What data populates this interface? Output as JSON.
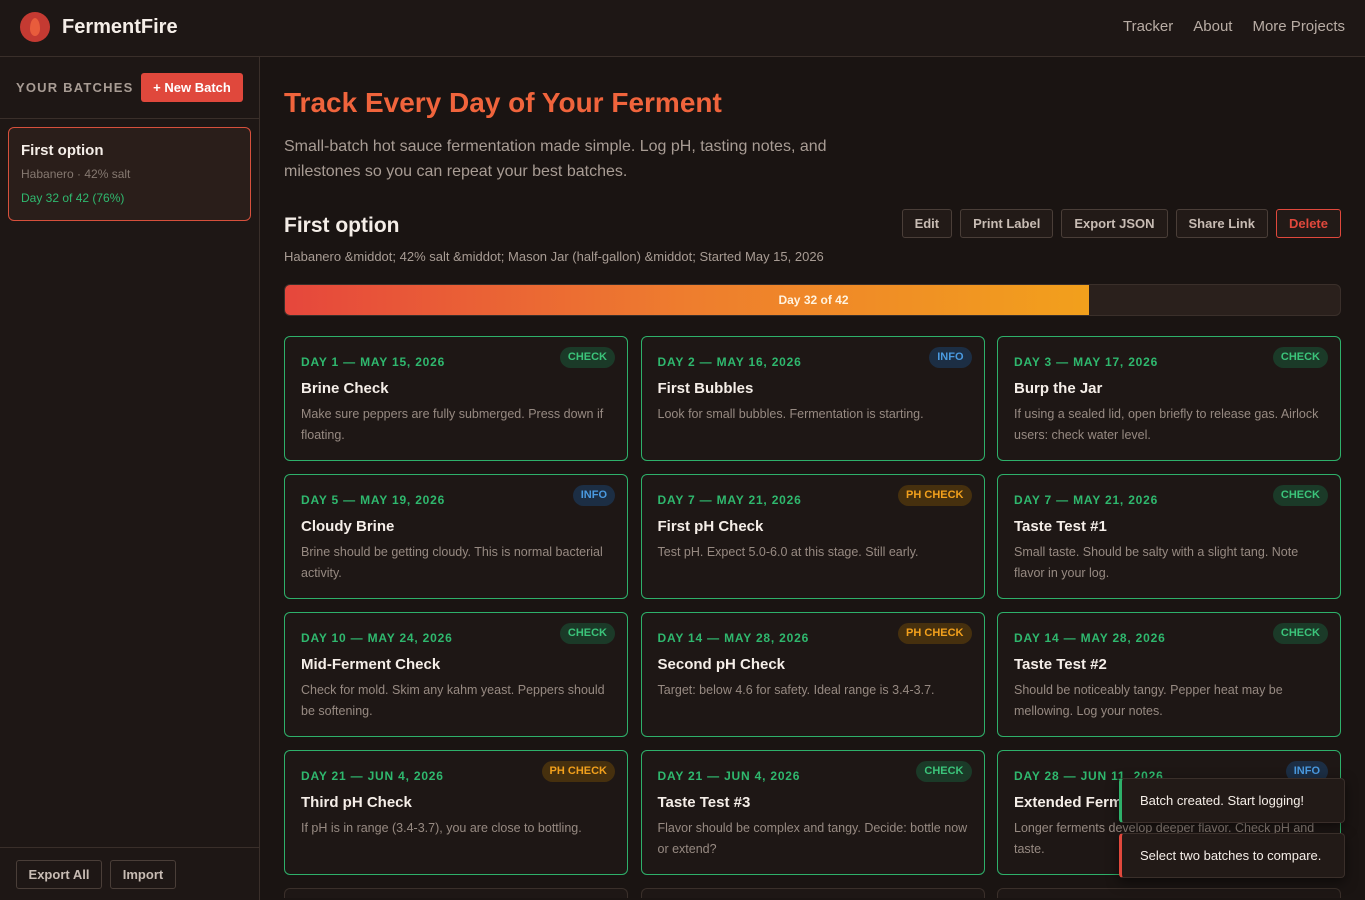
{
  "app": {
    "name": "FermentFire"
  },
  "nav": {
    "tracker": "Tracker",
    "about": "About",
    "more": "More Projects"
  },
  "sidebar": {
    "title": "YOUR BATCHES",
    "new_batch": "+ New Batch",
    "batches": [
      {
        "name": "First option",
        "meta": "Habanero · 42% salt",
        "progress": "Day 32 of 42 (76%)"
      }
    ],
    "export_all": "Export All",
    "import": "Import"
  },
  "hero": {
    "title": "Track Every Day of Your Ferment",
    "subtitle": "Small-batch hot sauce fermentation made simple. Log pH, tasting notes, and milestones so you can repeat your best batches."
  },
  "batch": {
    "title": "First option",
    "meta": "Habanero &middot; 42% salt &middot; Mason Jar (half-gallon) &middot; Started May 15, 2026",
    "actions": {
      "edit": "Edit",
      "print": "Print Label",
      "export": "Export JSON",
      "share": "Share Link",
      "delete": "Delete"
    },
    "progress_label": "Day 32 of 42",
    "progress_fraction": 0.7619
  },
  "badge_colors": {
    "check": "#3bc47a",
    "info": "#4a9ae0",
    "ph": "#f2a01c"
  },
  "milestones": [
    {
      "date": "DAY 1 — MAY 15, 2026",
      "badge": "CHECK",
      "type": "check",
      "title": "Brine Check",
      "text": "Make sure peppers are fully submerged. Press down if floating."
    },
    {
      "date": "DAY 2 — MAY 16, 2026",
      "badge": "INFO",
      "type": "info",
      "title": "First Bubbles",
      "text": "Look for small bubbles. Fermentation is starting."
    },
    {
      "date": "DAY 3 — MAY 17, 2026",
      "badge": "CHECK",
      "type": "check",
      "title": "Burp the Jar",
      "text": "If using a sealed lid, open briefly to release gas. Airlock users: check water level."
    },
    {
      "date": "DAY 5 — MAY 19, 2026",
      "badge": "INFO",
      "type": "info",
      "title": "Cloudy Brine",
      "text": "Brine should be getting cloudy. This is normal bacterial activity."
    },
    {
      "date": "DAY 7 — MAY 21, 2026",
      "badge": "PH CHECK",
      "type": "ph",
      "title": "First pH Check",
      "text": "Test pH. Expect 5.0-6.0 at this stage. Still early."
    },
    {
      "date": "DAY 7 — MAY 21, 2026",
      "badge": "CHECK",
      "type": "check",
      "title": "Taste Test #1",
      "text": "Small taste. Should be salty with a slight tang. Note flavor in your log."
    },
    {
      "date": "DAY 10 — MAY 24, 2026",
      "badge": "CHECK",
      "type": "check",
      "title": "Mid-Ferment Check",
      "text": "Check for mold. Skim any kahm yeast. Peppers should be softening."
    },
    {
      "date": "DAY 14 — MAY 28, 2026",
      "badge": "PH CHECK",
      "type": "ph",
      "title": "Second pH Check",
      "text": "Target: below 4.6 for safety. Ideal range is 3.4-3.7."
    },
    {
      "date": "DAY 14 — MAY 28, 2026",
      "badge": "CHECK",
      "type": "check",
      "title": "Taste Test #2",
      "text": "Should be noticeably tangy. Pepper heat may be mellowing. Log your notes."
    },
    {
      "date": "DAY 21 — JUN 4, 2026",
      "badge": "PH CHECK",
      "type": "ph",
      "title": "Third pH Check",
      "text": "If pH is in range (3.4-3.7), you are close to bottling."
    },
    {
      "date": "DAY 21 — JUN 4, 2026",
      "badge": "CHECK",
      "type": "check",
      "title": "Taste Test #3",
      "text": "Flavor should be complex and tangy. Decide: bottle now or extend?"
    },
    {
      "date": "DAY 28 — JUN 11, 2026",
      "badge": "INFO",
      "type": "info",
      "title": "Extended Ferment",
      "text": "Longer ferments develop deeper flavor. Check pH and taste."
    }
  ],
  "toasts": [
    {
      "text": "Batch created. Start logging!",
      "kind": "success"
    },
    {
      "text": "Select two batches to compare.",
      "kind": "error"
    }
  ]
}
